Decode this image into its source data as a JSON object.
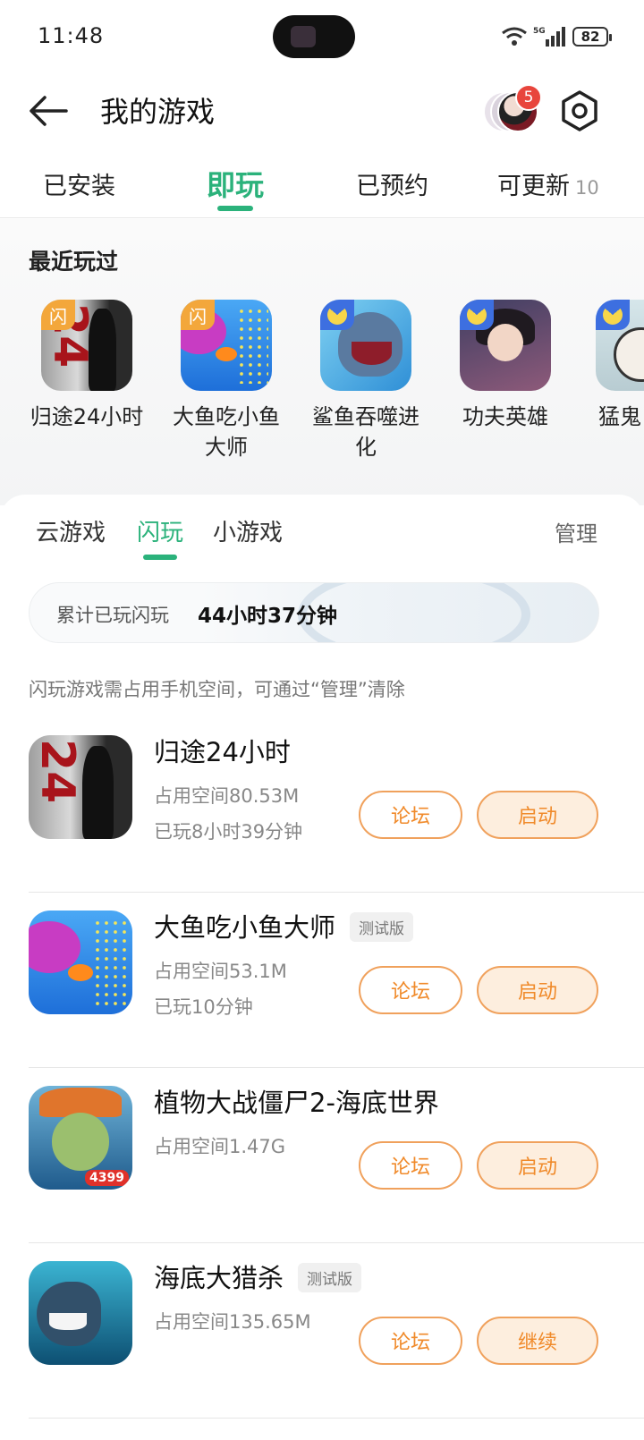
{
  "status_bar": {
    "time": "11:48",
    "network": "5G",
    "battery": "82"
  },
  "header": {
    "title": "我的游戏",
    "notification_count": "5"
  },
  "top_tabs": [
    {
      "label": "已安装",
      "active": false,
      "count": ""
    },
    {
      "label": "即玩",
      "active": true,
      "count": ""
    },
    {
      "label": "已预约",
      "active": false,
      "count": ""
    },
    {
      "label": "可更新",
      "active": false,
      "count": "10"
    }
  ],
  "recent": {
    "title": "最近玩过",
    "items": [
      {
        "name": "归途24小时",
        "tag": "闪",
        "icon": "game-24hours-icon"
      },
      {
        "name": "大鱼吃小鱼大师",
        "tag": "闪",
        "icon": "big-fish-icon"
      },
      {
        "name": "鲨鱼吞噬进化",
        "tag": "",
        "icon": "shark-evolution-icon"
      },
      {
        "name": "功夫英雄",
        "tag": "",
        "icon": "kungfu-hero-icon"
      },
      {
        "name": "猛鬼",
        "tag": "",
        "icon": "ghost-game-icon"
      }
    ]
  },
  "sub_tabs": [
    {
      "label": "云游戏",
      "active": false
    },
    {
      "label": "闪玩",
      "active": true
    },
    {
      "label": "小游戏",
      "active": false
    }
  ],
  "manage_label": "管理",
  "stats": {
    "label": "累计已玩闪玩",
    "value": "44小时37分钟"
  },
  "notice": "闪玩游戏需占用手机空间，可通过“管理”清除",
  "games": [
    {
      "name": "归途24小时",
      "beta": "",
      "size": "占用空间80.53M",
      "played": "已玩8小时39分钟",
      "forum": "论坛",
      "action": "启动"
    },
    {
      "name": "大鱼吃小鱼大师",
      "beta": "测试版",
      "size": "占用空间53.1M",
      "played": "已玩10分钟",
      "forum": "论坛",
      "action": "启动"
    },
    {
      "name": "植物大战僵尸2-海底世界",
      "beta": "",
      "size": "占用空间1.47G",
      "played": "",
      "forum": "论坛",
      "action": "启动",
      "icon_brand": "4399"
    },
    {
      "name": "海底大猎杀",
      "beta": "测试版",
      "size": "占用空间135.65M",
      "played": "",
      "forum": "论坛",
      "action": "继续"
    }
  ],
  "colors": {
    "accent": "#2bb27b",
    "action": "#f08a2a",
    "badge": "#e8453c"
  }
}
